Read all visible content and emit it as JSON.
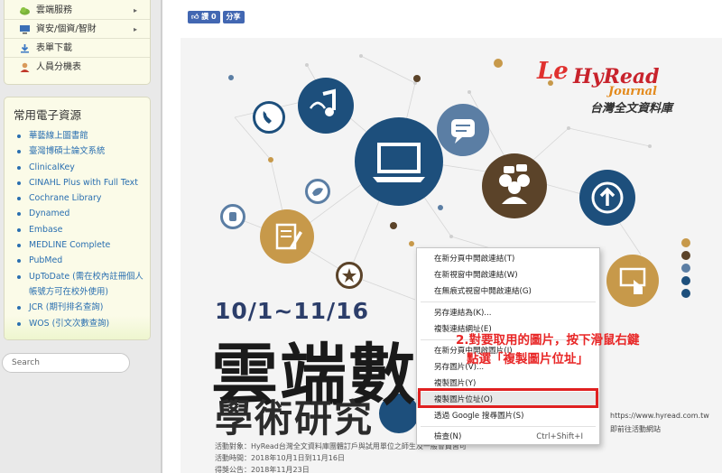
{
  "sidebar": {
    "menu": [
      {
        "label": "雲端服務",
        "icon": "cloud-icon",
        "has_arrow": true
      },
      {
        "label": "資安/個資/智財",
        "icon": "monitor-icon",
        "has_arrow": true
      },
      {
        "label": "表單下載",
        "icon": "download-icon",
        "has_arrow": false
      },
      {
        "label": "人員分機表",
        "icon": "person-icon",
        "has_arrow": false
      }
    ],
    "resources_title": "常用電子資源",
    "resources": [
      "華藝線上圖書館",
      "臺灣博碩士論文系統",
      "ClinicalKey",
      "CINAHL Plus with Full Text",
      "Cochrane Library",
      "Dynamed",
      "Embase",
      "MEDLINE Complete",
      "PubMed",
      "UpToDate (需在校內註冊個人",
      "帳號方可在校外使用)",
      "JCR (期刊排名查詢)",
      "WOS (引文次數查詢)"
    ],
    "search_placeholder": "Search"
  },
  "facebook": {
    "like_label": "讚 0",
    "share_label": "分享"
  },
  "poster": {
    "logo_le": "Le",
    "logo_hyread": "HyRead",
    "logo_journal": "Journal",
    "logo_subtitle": "台灣全文資料庫",
    "date": "10/1~11/16",
    "headline1": "雲端數位",
    "headline2": "學術研究",
    "url1": "https://www.hyread.com.tw",
    "url2": "即前往活動網站",
    "info": [
      "活動對象：HyRead台灣全文資料庫團體訂戶與試用單位之師生及一般會員皆可",
      "活動時間：2018年10月1日到11月16日",
      "得獎公告：2018年11月23日"
    ]
  },
  "context_menu": {
    "items": [
      {
        "label": "在新分頁中開啟連結(T)",
        "shortcut": ""
      },
      {
        "label": "在新視窗中開啟連結(W)",
        "shortcut": ""
      },
      {
        "label": "在無痕式視窗中開啟連結(G)",
        "shortcut": ""
      },
      {
        "label": "另存連結為(K)...",
        "shortcut": ""
      },
      {
        "label": "複製連結網址(E)",
        "shortcut": ""
      },
      {
        "label": "在新分頁中開啟圖片(I)",
        "shortcut": ""
      },
      {
        "label": "另存圖片(V)...",
        "shortcut": ""
      },
      {
        "label": "複製圖片(Y)",
        "shortcut": ""
      },
      {
        "label": "複製圖片位址(O)",
        "shortcut": ""
      },
      {
        "label": "透過 Google 搜尋圖片(S)",
        "shortcut": ""
      },
      {
        "label": "檢查(N)",
        "shortcut": "Ctrl+Shift+I"
      }
    ]
  },
  "annotation": {
    "line1": "2.對要取用的圖片，按下滑鼠右鍵",
    "line2": "點選「複製圖片位址」"
  },
  "colors": {
    "accent_red": "#e02020",
    "link_blue": "#2a6fb0",
    "icon_navy": "#1d4f7c",
    "icon_brown": "#5b4329",
    "icon_tan": "#c7994a"
  }
}
